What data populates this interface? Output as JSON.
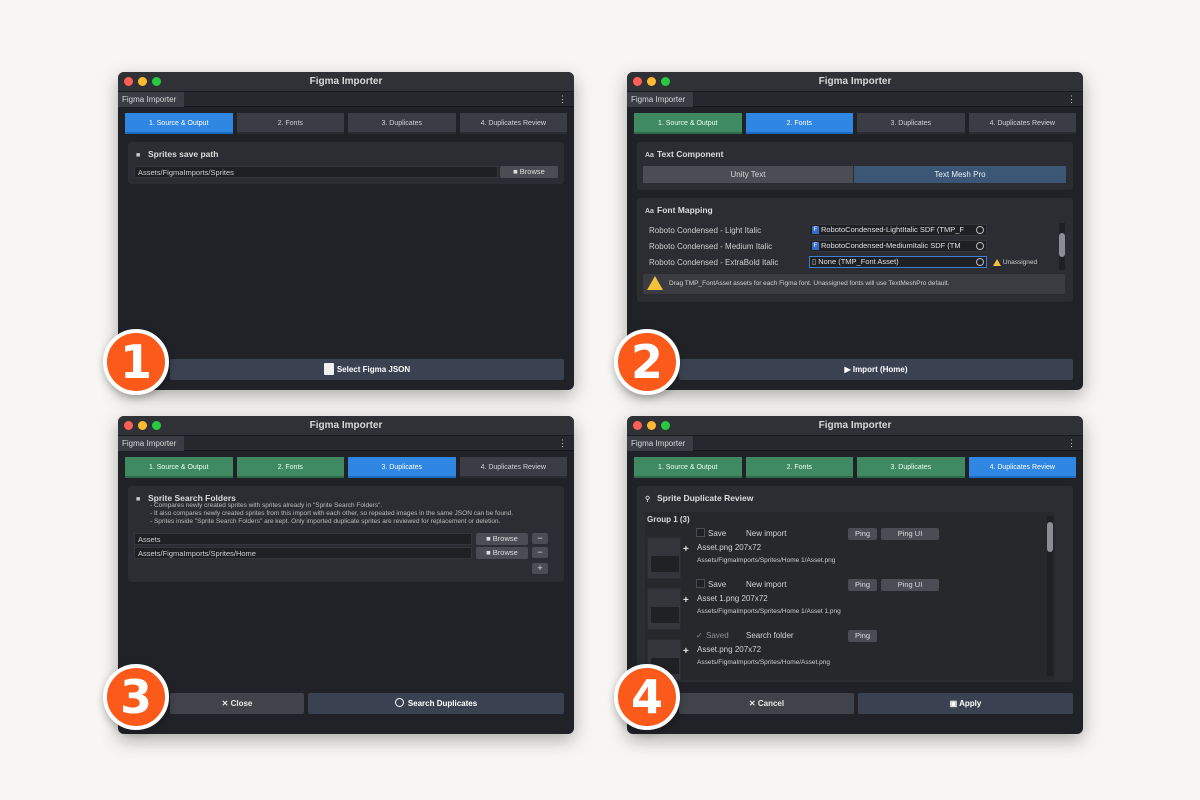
{
  "app_title": "Figma Importer",
  "doc_tab": "Figma Importer",
  "steps": [
    "1. Source & Output",
    "2. Fonts",
    "3. Duplicates",
    "4. Duplicates Review"
  ],
  "w1": {
    "section_title": "Sprites save path",
    "path_value": "Assets/FigmaImports/Sprites",
    "browse": "Browse",
    "action": "Select Figma JSON",
    "badge": "1"
  },
  "w2": {
    "text_component_title": "Text Component",
    "seg_left": "Unity Text",
    "seg_right": "Text Mesh Pro",
    "font_mapping_title": "Font Mapping",
    "rows": [
      {
        "font": "Roboto Condensed - Light Italic",
        "asset": "RobotoCondensed-LightItalic SDF (TMP_F"
      },
      {
        "font": "Roboto Condensed - Medium Italic",
        "asset": "RobotoCondensed-MediumItalic SDF (TM"
      },
      {
        "font": "Roboto Condensed - ExtraBold Italic",
        "asset": "None (TMP_Font Asset)"
      }
    ],
    "unassigned": "Unassigned",
    "help": "Drag TMP_FontAsset assets for each Figma font. Unassigned fonts will use TextMeshPro default.",
    "action": "Import (Home)",
    "badge": "2"
  },
  "w3": {
    "section_title": "Sprite Search Folders",
    "desc": [
      "- Compares newly created sprites with sprites already in \"Sprite Search Folders\".",
      "- It also compares newly created sprites from this import with each other, so repeated images in the same JSON can be found.",
      "- Sprites inside \"Sprite Search Folders\" are kept. Only imported duplicate sprites are reviewed for replacement or deletion."
    ],
    "folders": [
      "Assets",
      "Assets/FigmaImports/Sprites/Home"
    ],
    "browse": "Browse",
    "close": "Close",
    "search": "Search Duplicates",
    "badge": "3"
  },
  "w4": {
    "section_title": "Sprite Duplicate Review",
    "group": "Group 1 (3)",
    "items": [
      {
        "save": "Save",
        "kind": "New import",
        "name": "Asset.png",
        "size": "207x72",
        "path": "Assets/FigmaImports/Sprites/Home 1/Asset.png",
        "ping": "Ping",
        "ping_ui": "Ping UI"
      },
      {
        "save": "Save",
        "kind": "New import",
        "name": "Asset 1.png",
        "size": "207x72",
        "path": "Assets/FigmaImports/Sprites/Home 1/Asset 1.png",
        "ping": "Ping",
        "ping_ui": "Ping UI"
      },
      {
        "save": "Saved",
        "kind": "Search folder",
        "name": "Asset.png",
        "size": "207x72",
        "path": "Assets/FigmaImports/Sprites/Home/Asset.png",
        "ping": "Ping"
      }
    ],
    "cancel": "Cancel",
    "apply": "Apply",
    "badge": "4"
  }
}
